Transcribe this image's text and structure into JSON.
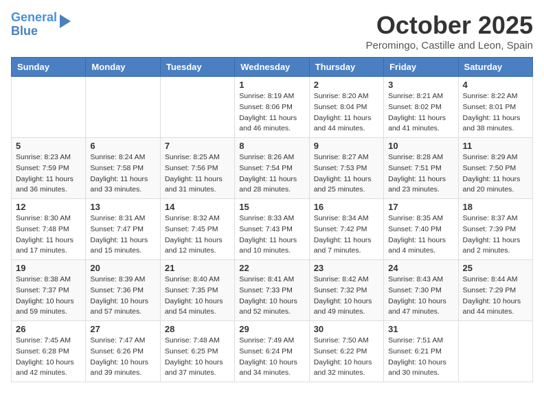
{
  "logo": {
    "line1": "General",
    "line2": "Blue"
  },
  "title": "October 2025",
  "location": "Peromingo, Castille and Leon, Spain",
  "weekdays": [
    "Sunday",
    "Monday",
    "Tuesday",
    "Wednesday",
    "Thursday",
    "Friday",
    "Saturday"
  ],
  "weeks": [
    [
      {
        "day": "",
        "sunrise": "",
        "sunset": "",
        "daylight": ""
      },
      {
        "day": "",
        "sunrise": "",
        "sunset": "",
        "daylight": ""
      },
      {
        "day": "",
        "sunrise": "",
        "sunset": "",
        "daylight": ""
      },
      {
        "day": "1",
        "sunrise": "Sunrise: 8:19 AM",
        "sunset": "Sunset: 8:06 PM",
        "daylight": "Daylight: 11 hours and 46 minutes."
      },
      {
        "day": "2",
        "sunrise": "Sunrise: 8:20 AM",
        "sunset": "Sunset: 8:04 PM",
        "daylight": "Daylight: 11 hours and 44 minutes."
      },
      {
        "day": "3",
        "sunrise": "Sunrise: 8:21 AM",
        "sunset": "Sunset: 8:02 PM",
        "daylight": "Daylight: 11 hours and 41 minutes."
      },
      {
        "day": "4",
        "sunrise": "Sunrise: 8:22 AM",
        "sunset": "Sunset: 8:01 PM",
        "daylight": "Daylight: 11 hours and 38 minutes."
      }
    ],
    [
      {
        "day": "5",
        "sunrise": "Sunrise: 8:23 AM",
        "sunset": "Sunset: 7:59 PM",
        "daylight": "Daylight: 11 hours and 36 minutes."
      },
      {
        "day": "6",
        "sunrise": "Sunrise: 8:24 AM",
        "sunset": "Sunset: 7:58 PM",
        "daylight": "Daylight: 11 hours and 33 minutes."
      },
      {
        "day": "7",
        "sunrise": "Sunrise: 8:25 AM",
        "sunset": "Sunset: 7:56 PM",
        "daylight": "Daylight: 11 hours and 31 minutes."
      },
      {
        "day": "8",
        "sunrise": "Sunrise: 8:26 AM",
        "sunset": "Sunset: 7:54 PM",
        "daylight": "Daylight: 11 hours and 28 minutes."
      },
      {
        "day": "9",
        "sunrise": "Sunrise: 8:27 AM",
        "sunset": "Sunset: 7:53 PM",
        "daylight": "Daylight: 11 hours and 25 minutes."
      },
      {
        "day": "10",
        "sunrise": "Sunrise: 8:28 AM",
        "sunset": "Sunset: 7:51 PM",
        "daylight": "Daylight: 11 hours and 23 minutes."
      },
      {
        "day": "11",
        "sunrise": "Sunrise: 8:29 AM",
        "sunset": "Sunset: 7:50 PM",
        "daylight": "Daylight: 11 hours and 20 minutes."
      }
    ],
    [
      {
        "day": "12",
        "sunrise": "Sunrise: 8:30 AM",
        "sunset": "Sunset: 7:48 PM",
        "daylight": "Daylight: 11 hours and 17 minutes."
      },
      {
        "day": "13",
        "sunrise": "Sunrise: 8:31 AM",
        "sunset": "Sunset: 7:47 PM",
        "daylight": "Daylight: 11 hours and 15 minutes."
      },
      {
        "day": "14",
        "sunrise": "Sunrise: 8:32 AM",
        "sunset": "Sunset: 7:45 PM",
        "daylight": "Daylight: 11 hours and 12 minutes."
      },
      {
        "day": "15",
        "sunrise": "Sunrise: 8:33 AM",
        "sunset": "Sunset: 7:43 PM",
        "daylight": "Daylight: 11 hours and 10 minutes."
      },
      {
        "day": "16",
        "sunrise": "Sunrise: 8:34 AM",
        "sunset": "Sunset: 7:42 PM",
        "daylight": "Daylight: 11 hours and 7 minutes."
      },
      {
        "day": "17",
        "sunrise": "Sunrise: 8:35 AM",
        "sunset": "Sunset: 7:40 PM",
        "daylight": "Daylight: 11 hours and 4 minutes."
      },
      {
        "day": "18",
        "sunrise": "Sunrise: 8:37 AM",
        "sunset": "Sunset: 7:39 PM",
        "daylight": "Daylight: 11 hours and 2 minutes."
      }
    ],
    [
      {
        "day": "19",
        "sunrise": "Sunrise: 8:38 AM",
        "sunset": "Sunset: 7:37 PM",
        "daylight": "Daylight: 10 hours and 59 minutes."
      },
      {
        "day": "20",
        "sunrise": "Sunrise: 8:39 AM",
        "sunset": "Sunset: 7:36 PM",
        "daylight": "Daylight: 10 hours and 57 minutes."
      },
      {
        "day": "21",
        "sunrise": "Sunrise: 8:40 AM",
        "sunset": "Sunset: 7:35 PM",
        "daylight": "Daylight: 10 hours and 54 minutes."
      },
      {
        "day": "22",
        "sunrise": "Sunrise: 8:41 AM",
        "sunset": "Sunset: 7:33 PM",
        "daylight": "Daylight: 10 hours and 52 minutes."
      },
      {
        "day": "23",
        "sunrise": "Sunrise: 8:42 AM",
        "sunset": "Sunset: 7:32 PM",
        "daylight": "Daylight: 10 hours and 49 minutes."
      },
      {
        "day": "24",
        "sunrise": "Sunrise: 8:43 AM",
        "sunset": "Sunset: 7:30 PM",
        "daylight": "Daylight: 10 hours and 47 minutes."
      },
      {
        "day": "25",
        "sunrise": "Sunrise: 8:44 AM",
        "sunset": "Sunset: 7:29 PM",
        "daylight": "Daylight: 10 hours and 44 minutes."
      }
    ],
    [
      {
        "day": "26",
        "sunrise": "Sunrise: 7:45 AM",
        "sunset": "Sunset: 6:28 PM",
        "daylight": "Daylight: 10 hours and 42 minutes."
      },
      {
        "day": "27",
        "sunrise": "Sunrise: 7:47 AM",
        "sunset": "Sunset: 6:26 PM",
        "daylight": "Daylight: 10 hours and 39 minutes."
      },
      {
        "day": "28",
        "sunrise": "Sunrise: 7:48 AM",
        "sunset": "Sunset: 6:25 PM",
        "daylight": "Daylight: 10 hours and 37 minutes."
      },
      {
        "day": "29",
        "sunrise": "Sunrise: 7:49 AM",
        "sunset": "Sunset: 6:24 PM",
        "daylight": "Daylight: 10 hours and 34 minutes."
      },
      {
        "day": "30",
        "sunrise": "Sunrise: 7:50 AM",
        "sunset": "Sunset: 6:22 PM",
        "daylight": "Daylight: 10 hours and 32 minutes."
      },
      {
        "day": "31",
        "sunrise": "Sunrise: 7:51 AM",
        "sunset": "Sunset: 6:21 PM",
        "daylight": "Daylight: 10 hours and 30 minutes."
      },
      {
        "day": "",
        "sunrise": "",
        "sunset": "",
        "daylight": ""
      }
    ]
  ]
}
